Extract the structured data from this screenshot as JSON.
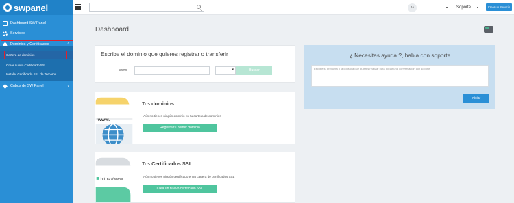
{
  "app": {
    "logo_text": "swpanel"
  },
  "sidebar": {
    "items": [
      {
        "label": "Dashboard SW Panel",
        "icon": "monitor-icon"
      },
      {
        "label": "Servicios",
        "icon": "gear-icon"
      },
      {
        "label": "Dominios y Certificados",
        "icon": "users-icon",
        "expanded": true
      },
      {
        "label": "Cubos de SW Panel",
        "icon": "cubes-icon"
      }
    ],
    "submenu": [
      {
        "label": "Cartera de dominios",
        "active": true
      },
      {
        "label": "Crear nuevo Certificado SSL",
        "active": false
      },
      {
        "label": "Instalar Certificado SSL de Terceros",
        "active": false
      }
    ]
  },
  "topbar": {
    "search_value": "",
    "avatar_initials": "JA",
    "support_label": "Soporte",
    "create_service_label": "Crear un Servicio"
  },
  "main": {
    "title": "Dashboard",
    "register": {
      "title": "Escribe el dominio que quieres registrar o transferir",
      "prefix": "www.",
      "dot": ".",
      "domain_value": "",
      "search_label": "Buscar"
    },
    "help": {
      "title": "¿ Necesitas ayuda ?, habla con soporte",
      "placeholder": "Escribe tu pregunta o la consulta que quieres realizar para iniciar una conversación con soporte",
      "start_label": "Iniciar"
    },
    "domains": {
      "title_prefix": "Tus ",
      "title_strong": "dominios",
      "text": "Aún no tienes ningún dominio en tu cartera de dominios",
      "button": "Registra tu primer dominio",
      "illus_text": "www."
    },
    "ssl": {
      "title_prefix": "Tus ",
      "title_strong": "Certificados SSL",
      "text": "Aún no tienes ningún certificado en tu cartera de certificados SSL",
      "button": "Crea un nuevo certificado SSL",
      "illus_text": "https://www."
    }
  },
  "colors": {
    "sidebar": "#2a8fd6",
    "primary_button": "#2a8fd6",
    "green_button": "#4fc59e",
    "highlight": "#e0212e",
    "help_panel": "#c7def0"
  }
}
